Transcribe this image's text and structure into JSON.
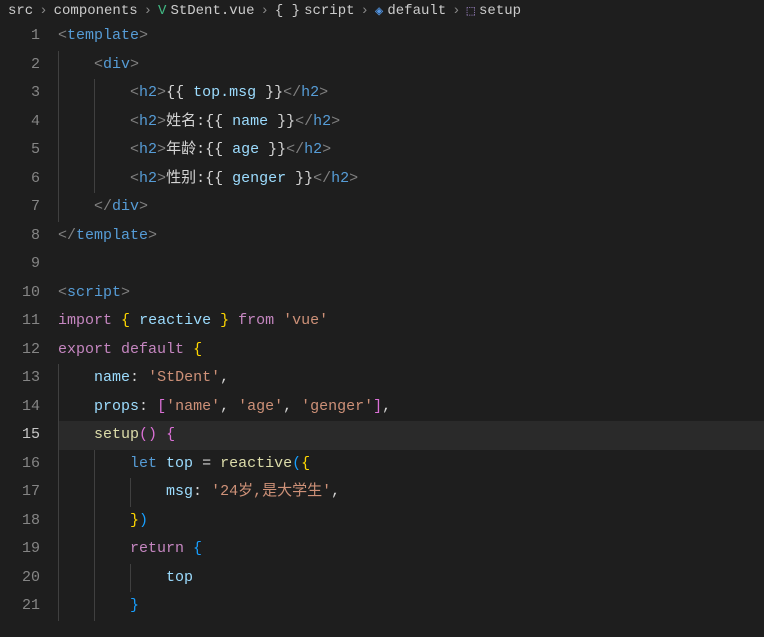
{
  "breadcrumb": {
    "src": "src",
    "components": "components",
    "file": "StDent.vue",
    "script": "script",
    "default": "default",
    "setup": "setup"
  },
  "lineNumbers": [
    "1",
    "2",
    "3",
    "4",
    "5",
    "6",
    "7",
    "8",
    "9",
    "10",
    "11",
    "12",
    "13",
    "14",
    "15",
    "16",
    "17",
    "18",
    "19",
    "20",
    "21"
  ],
  "activeLine": "15",
  "code": {
    "template": "template",
    "div": "div",
    "h2": "h2",
    "top_msg": "top.msg",
    "name_label": "姓名:",
    "age_label": "年龄:",
    "gender_label": "性别:",
    "name_var": "name",
    "age_var": "age",
    "genger_var": "genger",
    "script": "script",
    "import": "import",
    "reactive": "reactive",
    "from": "from",
    "vue": "'vue'",
    "export": "export",
    "default": "default",
    "name_key": "name",
    "stdent": "'StDent'",
    "props_key": "props",
    "name_str": "'name'",
    "age_str": "'age'",
    "genger_str": "'genger'",
    "setup": "setup",
    "let": "let",
    "top": "top",
    "msg_key": "msg",
    "msg_val": "'24岁,是大学生'",
    "return": "return"
  }
}
